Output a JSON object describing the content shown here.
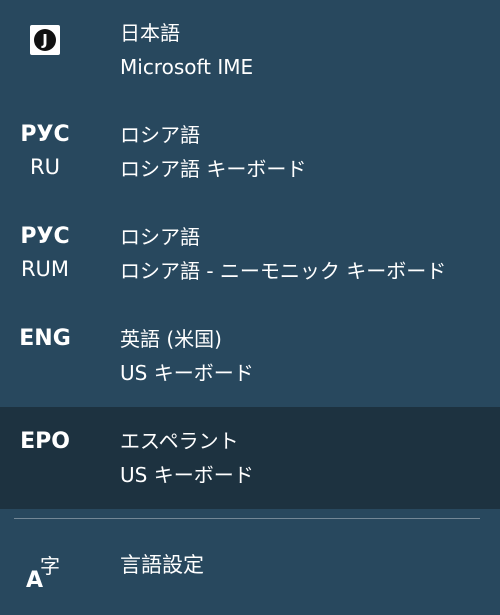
{
  "items": [
    {
      "icon": "ime-j-icon",
      "abbr": "",
      "sub": "",
      "line1": "日本語",
      "line2": "Microsoft IME",
      "selected": false
    },
    {
      "icon": "",
      "abbr": "РУС",
      "sub": "RU",
      "line1": "ロシア語",
      "line2": "ロシア語 キーボード",
      "selected": false
    },
    {
      "icon": "",
      "abbr": "РУС",
      "sub": "RUM",
      "line1": "ロシア語",
      "line2": "ロシア語 - ニーモニック キーボード",
      "selected": false
    },
    {
      "icon": "",
      "abbr": "ENG",
      "sub": "",
      "line1": "英語 (米国)",
      "line2": "US キーボード",
      "selected": false
    },
    {
      "icon": "",
      "abbr": "EPO",
      "sub": "",
      "line1": "エスペラント",
      "line2": "US キーボード",
      "selected": true
    }
  ],
  "ime_icon_letter": "J",
  "settings": {
    "icon_letter_a": "A",
    "icon_letter_k": "字",
    "label": "言語設定"
  },
  "colors": {
    "background": "#28485e",
    "selected_row": "#1f313d",
    "text": "#ffffff"
  }
}
